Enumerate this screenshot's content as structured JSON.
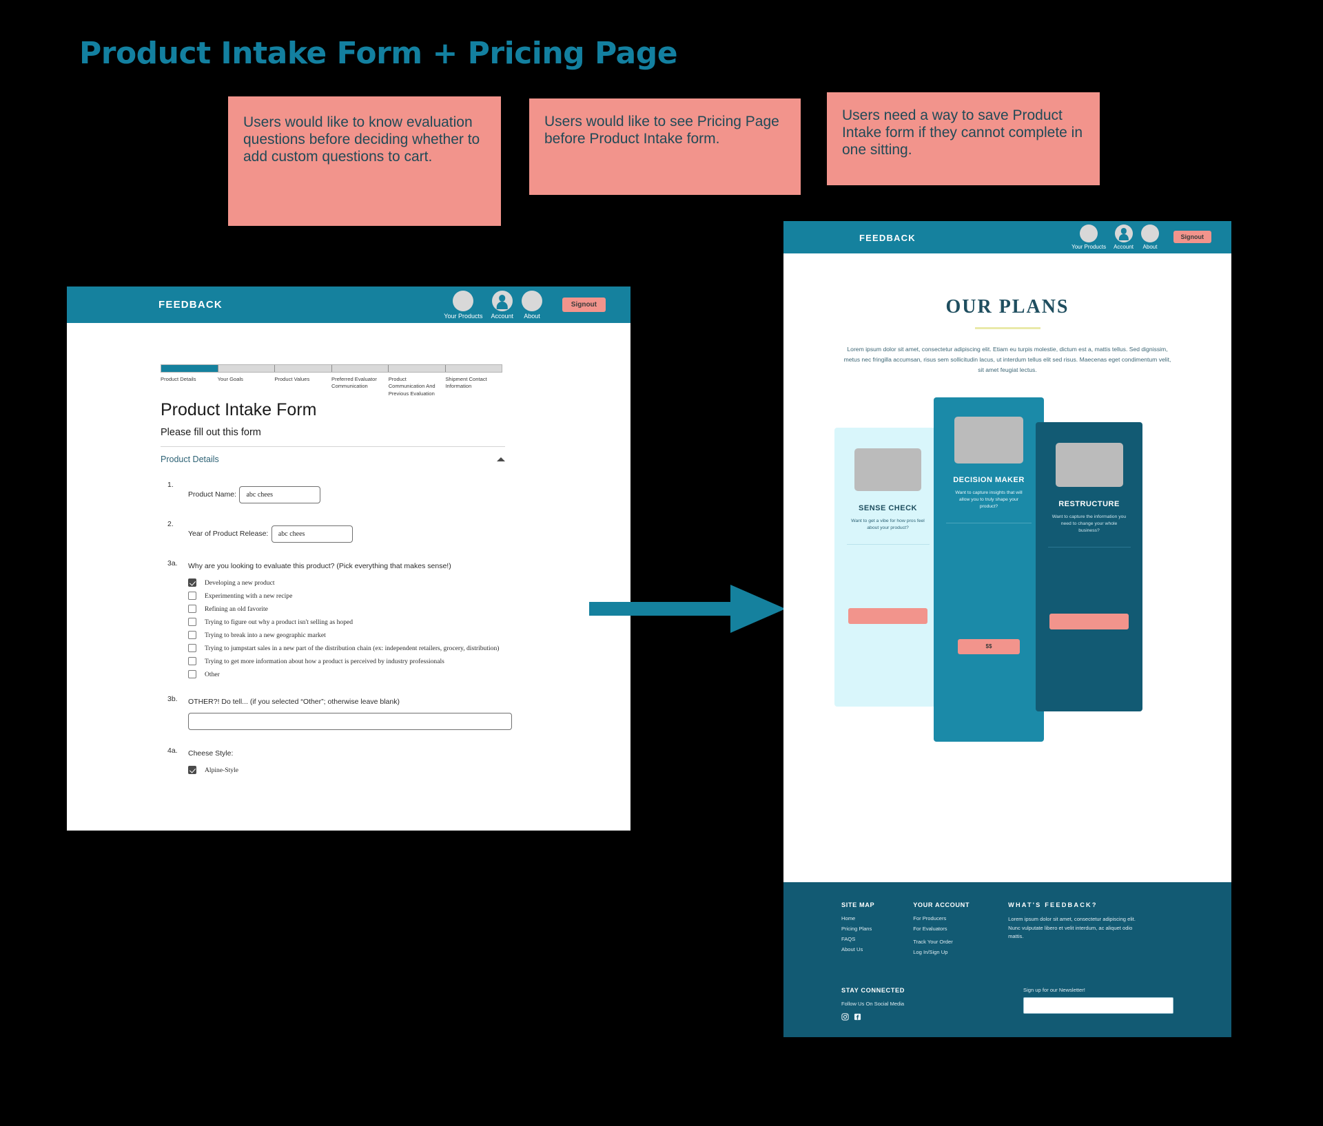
{
  "slide": {
    "title": "Product Intake Form + Pricing Page",
    "title_color": "#1380a0",
    "background": "#000000"
  },
  "sticky_notes": [
    {
      "id": "note-1",
      "text": "Users would like to know evaluation questions before deciding whether to add custom questions to cart.",
      "color": "#f2948c"
    },
    {
      "id": "note-2",
      "text": "Users would like to see Pricing Page before Product Intake form.",
      "color": "#f2948c"
    },
    {
      "id": "note-3",
      "text": "Users need a way to save Product Intake form if they cannot complete in one sitting.",
      "color": "#f2948c"
    }
  ],
  "arrow": {
    "name": "flow-arrow",
    "color": "#15819e",
    "direction": "right"
  },
  "intake_screen": {
    "nav": {
      "brand": "FEEDBACK",
      "brand_color": "#ffffff",
      "bar_color": "#15819e",
      "items": [
        {
          "label": "Your Products",
          "icon": "circle-avatar-icon"
        },
        {
          "label": "Account",
          "icon": "person-account-icon"
        },
        {
          "label": "About",
          "icon": "circle-avatar-icon"
        }
      ],
      "signout_label": "Signout",
      "signout_color": "#f2948c"
    },
    "progress": {
      "active_index": 0,
      "active_color": "#15819e",
      "steps": [
        "Product Details",
        "Your Goals",
        "Product Values",
        "Preferred Evaluator Communication",
        "Product Communication And Previous Evaluation",
        "Shipment Contact Information"
      ]
    },
    "form": {
      "title": "Product Intake Form",
      "subtitle": "Please fill out this form",
      "section_title": "Product Details",
      "section_toggle_icon": "chevron-up-icon",
      "questions": [
        {
          "number": "1.",
          "text": "Product Name:",
          "type": "text",
          "value": "abc chees"
        },
        {
          "number": "2.",
          "text": "Year of Product Release:",
          "type": "text",
          "value": "abc chees"
        },
        {
          "number": "3a.",
          "text": "Why are you looking to evaluate this product? (Pick everything that makes sense!)",
          "type": "checkbox-group",
          "options": [
            {
              "label": "Developing a new product",
              "checked": true
            },
            {
              "label": "Experimenting with a new recipe",
              "checked": false
            },
            {
              "label": "Refining an old favorite",
              "checked": false
            },
            {
              "label": "Trying to figure out why a product isn't selling as hoped",
              "checked": false
            },
            {
              "label": "Trying to break into a new geographic market",
              "checked": false
            },
            {
              "label": "Trying to jumpstart sales in a new part of the distribution chain (ex: independent retailers, grocery, distribution)",
              "checked": false
            },
            {
              "label": "Trying to get more information about how a product is perceived by industry professionals",
              "checked": false
            },
            {
              "label": "Other",
              "checked": false
            }
          ]
        },
        {
          "number": "3b.",
          "text": "OTHER?! Do tell... (if you selected “Other”; otherwise leave blank)",
          "type": "text-wide",
          "value": ""
        },
        {
          "number": "4a.",
          "text": "Cheese Style:",
          "type": "checkbox-group",
          "options": [
            {
              "label": "Alpine-Style",
              "checked": true
            }
          ]
        }
      ]
    }
  },
  "pricing_screen": {
    "nav": {
      "brand": "FEEDBACK",
      "items": [
        {
          "label": "Your Products",
          "icon": "circle-avatar-icon"
        },
        {
          "label": "Account",
          "icon": "person-account-icon"
        },
        {
          "label": "About",
          "icon": "circle-avatar-icon"
        }
      ],
      "signout_label": "Signout"
    },
    "heading": "OUR PLANS",
    "underline_color": "#e9e9a8",
    "description": "Lorem ipsum dolor sit amet, consectetur adipiscing elit. Etiam eu turpis molestie, dictum est a, mattis tellus. Sed dignissim, metus nec fringilla accumsan, risus sem sollicitudin lacus, ut interdum tellus elit sed risus. Maecenas eget condimentum velit, sit amet feugiat lectus.",
    "plans": [
      {
        "name": "SENSE CHECK",
        "description": "Want to get a vibe for how pros feel about your product?",
        "button_label": "",
        "bg_color": "#d9f6fb",
        "featured": false
      },
      {
        "name": "DECISION MAKER",
        "description": "Want to capture insights that will allow you to truly shape your product?",
        "button_label": "$$",
        "bg_color": "#1b8aa8",
        "featured": true
      },
      {
        "name": "RESTRUCTURE",
        "description": "Want to capture the information you need to change your whole business?",
        "button_label": "",
        "bg_color": "#125a73",
        "featured": false
      }
    ],
    "footer": {
      "bg_color": "#125a73",
      "site_map": {
        "heading": "SITE MAP",
        "links": [
          "Home",
          "Pricing Plans",
          "FAQS",
          "About Us"
        ]
      },
      "your_account": {
        "heading": "YOUR ACCOUNT",
        "links": [
          "For Producers",
          "For Evaluators",
          "Track Your Order",
          "Log In/Sign Up"
        ]
      },
      "whats_feedback": {
        "heading": "WHAT'S FEEDBACK?",
        "text": "Lorem ipsum dolor sit amet, consectetur adipiscing elit. Nunc vulputate libero et velit interdum, ac aliquet odio mattis."
      },
      "stay_connected": {
        "heading": "STAY CONNECTED",
        "subtext": "Follow Us On Social Media",
        "icons": [
          "instagram-icon",
          "facebook-icon"
        ]
      },
      "newsletter": {
        "label": "Sign up for our Newsletter!",
        "value": "",
        "placeholder": ""
      }
    }
  }
}
